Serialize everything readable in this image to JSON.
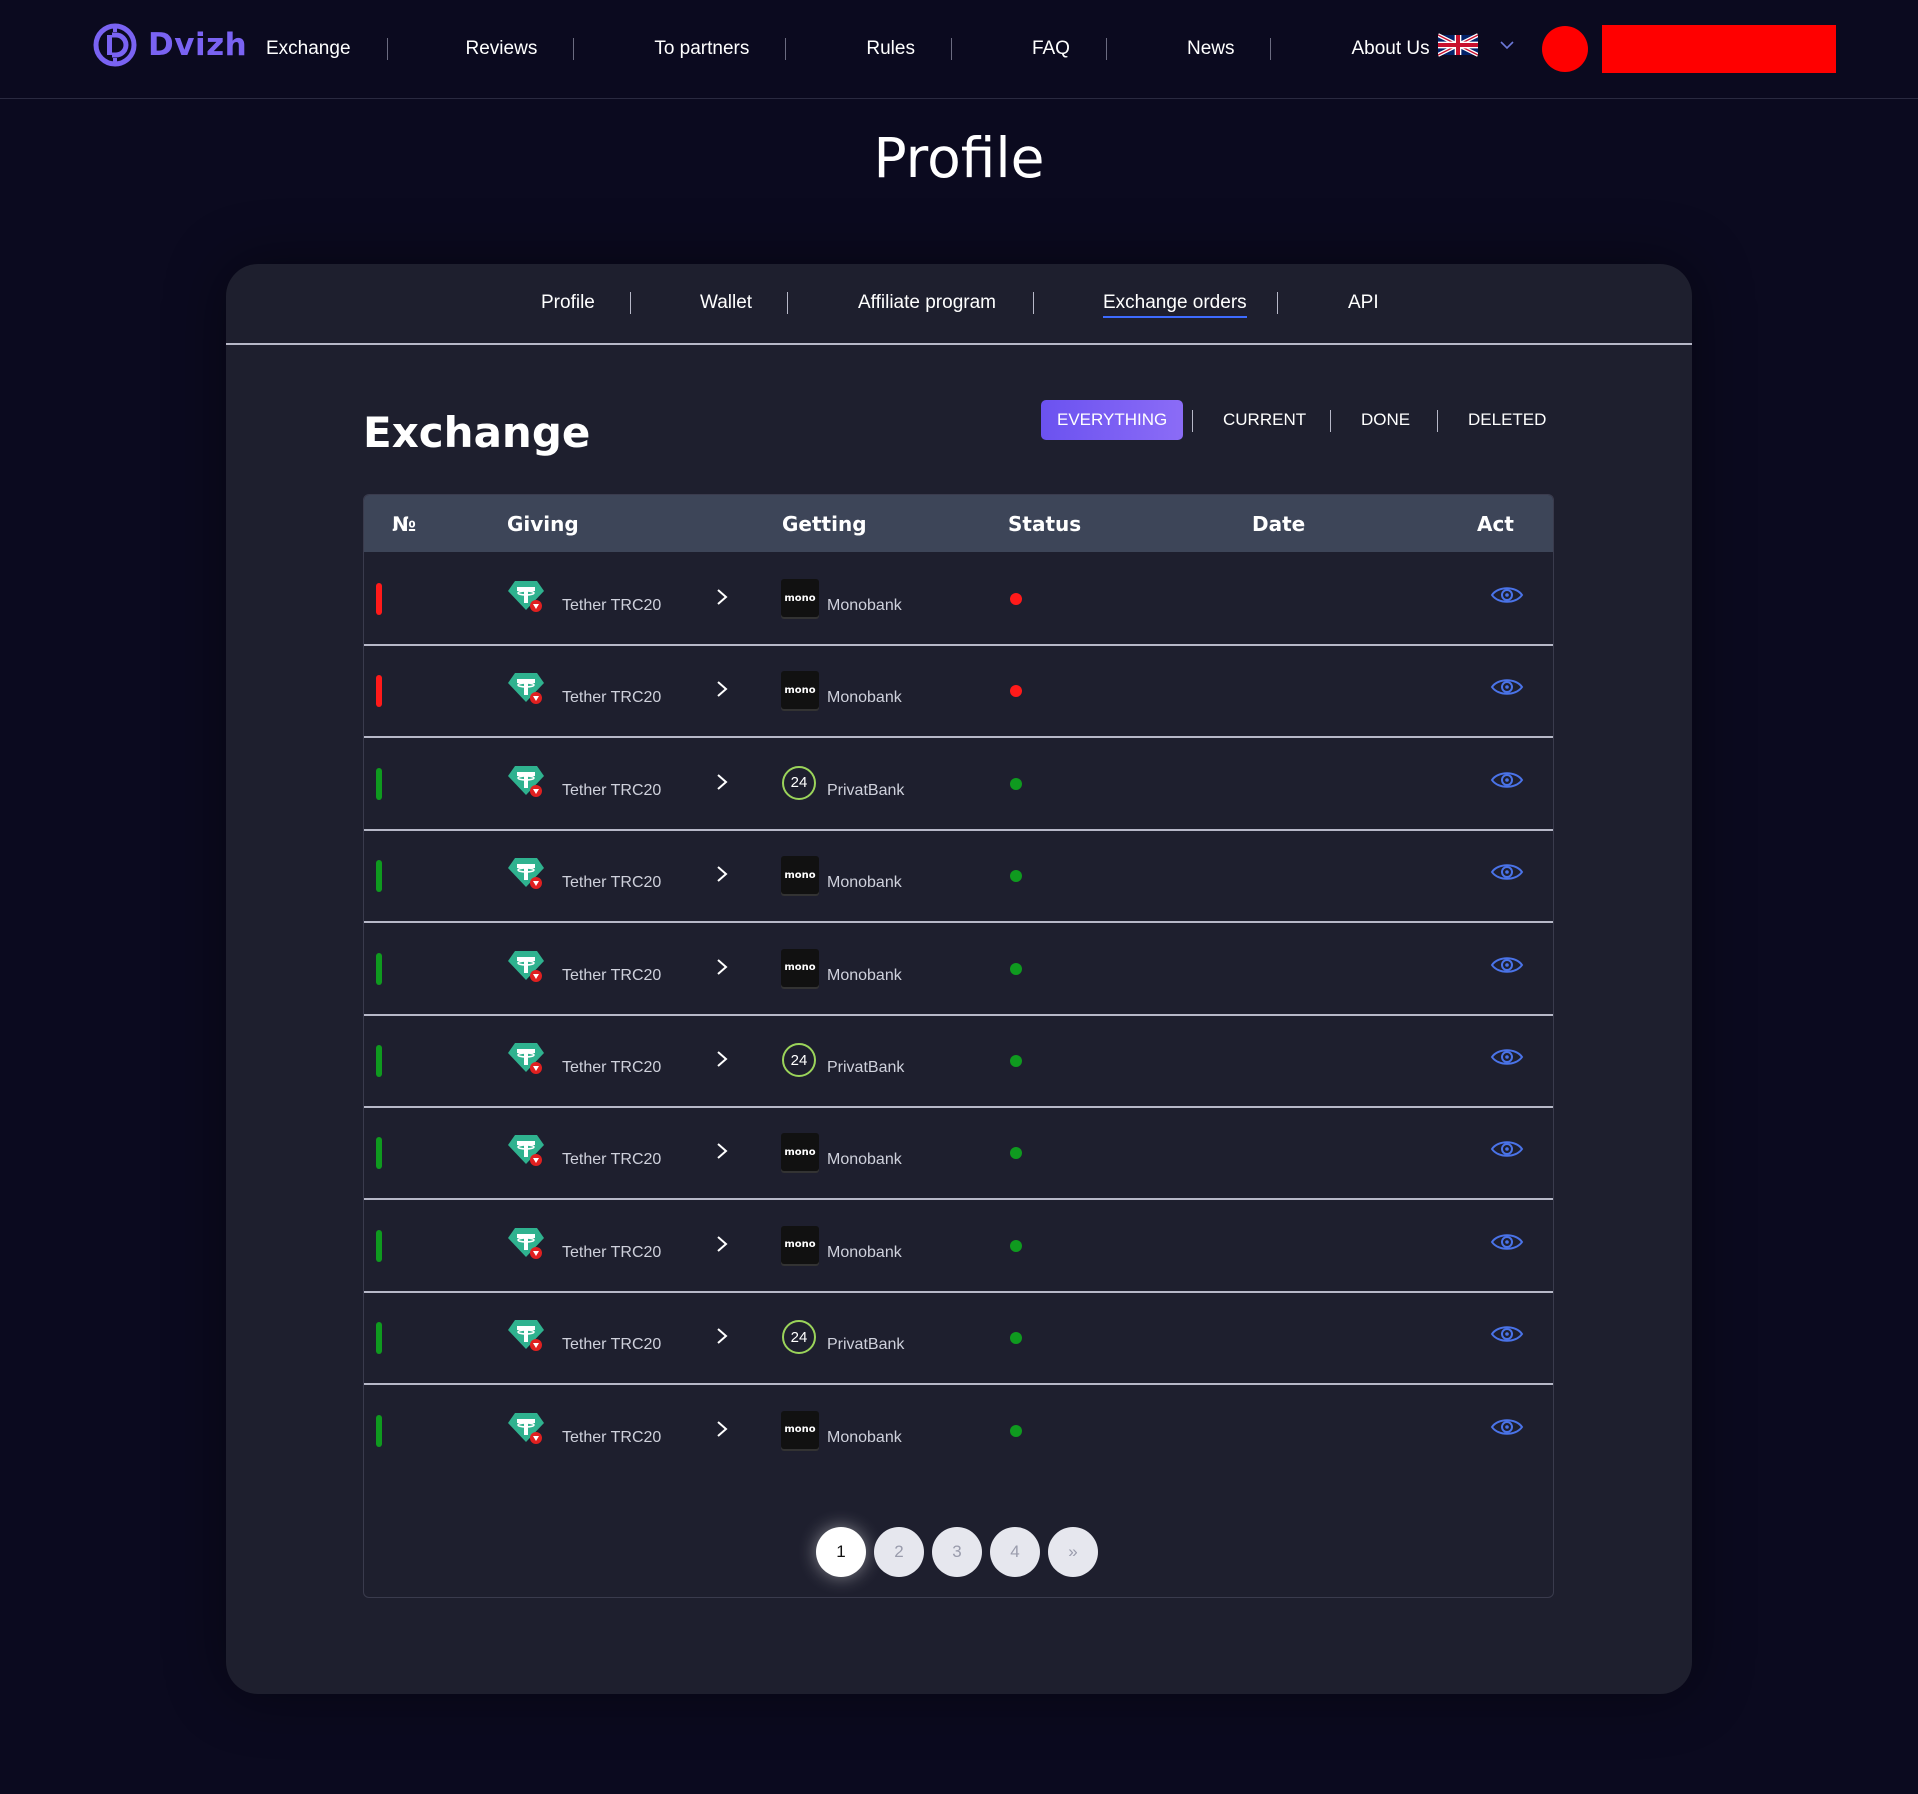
{
  "brand": {
    "name": "Dvizh"
  },
  "nav": {
    "items": [
      "Exchange",
      "Reviews",
      "To partners",
      "Rules",
      "FAQ",
      "News",
      "About Us"
    ]
  },
  "header": {
    "language_icon": "uk-flag-icon"
  },
  "page": {
    "title": "Profile"
  },
  "tabs": [
    "Profile",
    "Wallet",
    "Affiliate program",
    "Exchange orders",
    "API"
  ],
  "tabs_active": "Exchange orders",
  "section": {
    "title": "Exchange"
  },
  "filters": [
    "EVERYTHING",
    "CURRENT",
    "DONE",
    "DELETED"
  ],
  "filters_active": "EVERYTHING",
  "table": {
    "headers": [
      "№",
      "Giving",
      "Getting",
      "Status",
      "Date",
      "Act"
    ],
    "rows": [
      {
        "giving": "Tether TRC20",
        "getting": "Monobank",
        "bank_logo": "mono",
        "status_color": "#ff1a1a"
      },
      {
        "giving": "Tether TRC20",
        "getting": "Monobank",
        "bank_logo": "mono",
        "status_color": "#ff1a1a"
      },
      {
        "giving": "Tether TRC20",
        "getting": "PrivatBank",
        "bank_logo": "24",
        "status_color": "#0f9a1f"
      },
      {
        "giving": "Tether TRC20",
        "getting": "Monobank",
        "bank_logo": "mono",
        "status_color": "#0f9a1f"
      },
      {
        "giving": "Tether TRC20",
        "getting": "Monobank",
        "bank_logo": "mono",
        "status_color": "#0f9a1f"
      },
      {
        "giving": "Tether TRC20",
        "getting": "PrivatBank",
        "bank_logo": "24",
        "status_color": "#0f9a1f"
      },
      {
        "giving": "Tether TRC20",
        "getting": "Monobank",
        "bank_logo": "mono",
        "status_color": "#0f9a1f"
      },
      {
        "giving": "Tether TRC20",
        "getting": "Monobank",
        "bank_logo": "mono",
        "status_color": "#0f9a1f"
      },
      {
        "giving": "Tether TRC20",
        "getting": "PrivatBank",
        "bank_logo": "24",
        "status_color": "#0f9a1f"
      },
      {
        "giving": "Tether TRC20",
        "getting": "Monobank",
        "bank_logo": "mono",
        "status_color": "#0f9a1f"
      }
    ]
  },
  "pagination": {
    "pages": [
      "1",
      "2",
      "3",
      "4"
    ],
    "next": "»",
    "current": "1"
  },
  "colors": {
    "accent": "#7a63f2",
    "link_underline": "#3d6bff",
    "danger": "#ff1a1a",
    "success": "#0f9a1f"
  }
}
